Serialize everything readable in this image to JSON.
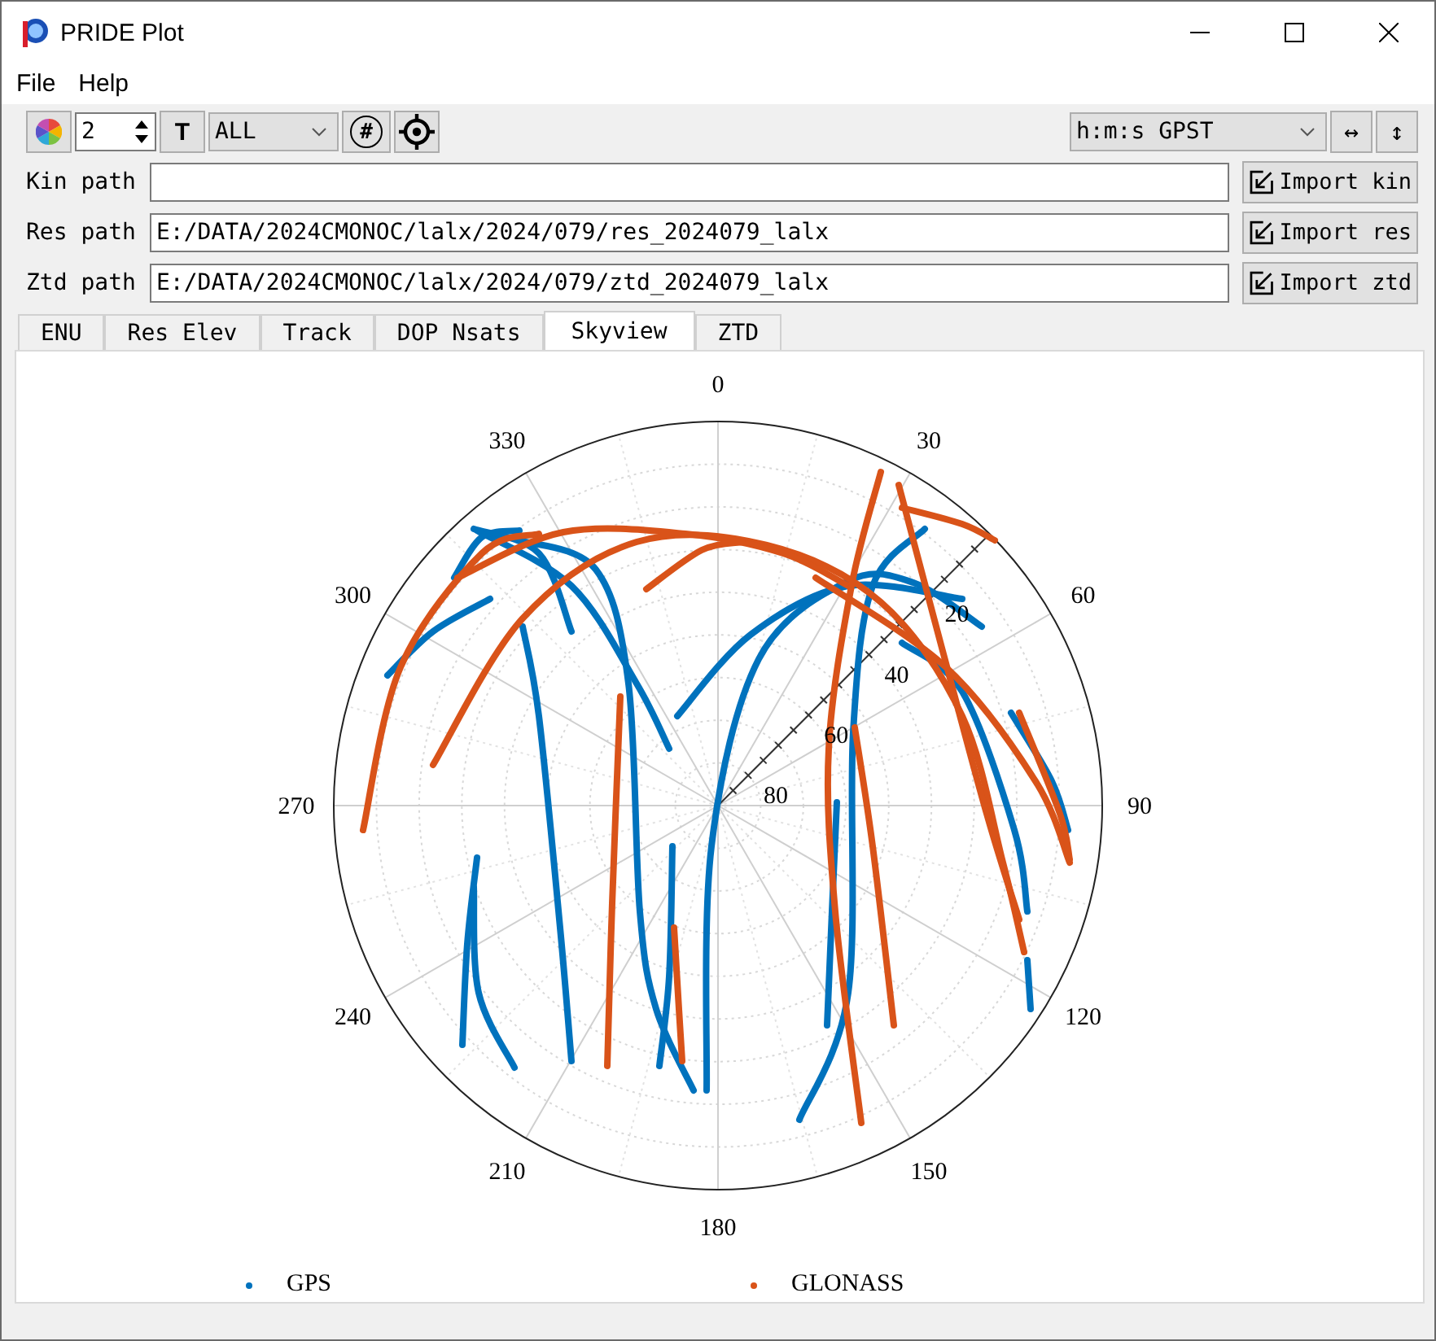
{
  "window": {
    "title": "PRIDE Plot"
  },
  "menu": [
    "File",
    "Help"
  ],
  "toolbar": {
    "spin_value": "2",
    "text_button": "T",
    "system_select": "ALL",
    "grid_button": "#",
    "time_select": "h:m:s GPST",
    "fit_x_button": "↔",
    "fit_y_button": "↕"
  },
  "paths": [
    {
      "label": "Kin path",
      "button": "Import kin"
    },
    {
      "label": "Res path",
      "value": "E:/DATA/2024CMONOC/lalx/2024/079/res_2024079_lalx",
      "button": "Import res"
    },
    {
      "label": "Ztd path",
      "value": "E:/DATA/2024CMONOC/lalx/2024/079/ztd_2024079_lalx",
      "button": "Import ztd"
    }
  ],
  "tabs": [
    {
      "label": "ENU",
      "selected": false
    },
    {
      "label": "Res Elev",
      "selected": false
    },
    {
      "label": "Track",
      "selected": false
    },
    {
      "label": "DOP Nsats",
      "selected": false
    },
    {
      "label": "Skyview",
      "selected": true
    },
    {
      "label": "ZTD",
      "selected": false
    }
  ],
  "skyview": {
    "azimuth_labels": [
      "0",
      "30",
      "60",
      "90",
      "120",
      "150",
      "180",
      "210",
      "240",
      "270",
      "300",
      "330"
    ],
    "elevation_labels": [
      "20",
      "40",
      "60",
      "80"
    ],
    "legend": [
      {
        "name": "GPS",
        "color": "#0072bd"
      },
      {
        "name": "GLONASS",
        "color": "#d95319"
      }
    ]
  }
}
